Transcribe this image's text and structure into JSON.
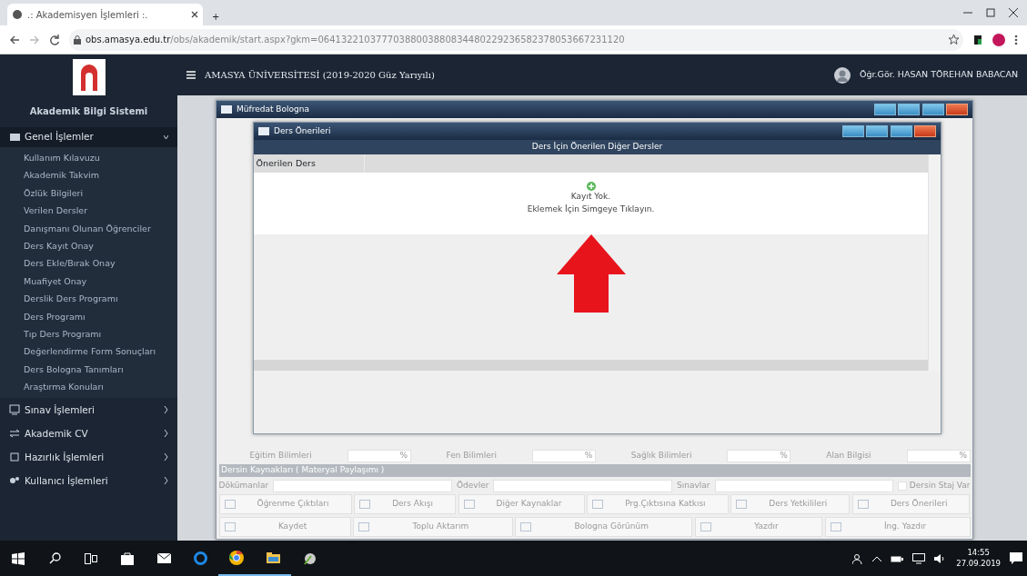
{
  "browser": {
    "tab_title": ".: Akademisyen İşlemleri :.",
    "new_tab": "+",
    "url": "**obs.amasya.edu.tr**/obs/akademik/start.aspx?gkm=06413221037770388003880834480229236582378053667231120"
  },
  "header": {
    "title": "AMASYA ÜNİVERSİTESİ (2019-2020 Güz Yarıyılı)",
    "user": "Öğr.Gör. HASAN TÖREHAN BABACAN"
  },
  "sidebar": {
    "title": "Akademik Bilgi Sistemi",
    "groups": [
      {
        "label": "Genel İşlemler",
        "expanded": true,
        "children": [
          {
            "label": "Kullanım Kılavuzu"
          },
          {
            "label": "Akademik Takvim"
          },
          {
            "label": "Özlük Bilgileri"
          },
          {
            "label": "Verilen Dersler"
          },
          {
            "label": "Danışmanı Olunan Öğrenciler"
          },
          {
            "label": "Ders Kayıt Onay"
          },
          {
            "label": "Ders Ekle/Bırak Onay"
          },
          {
            "label": "Muafiyet Onay"
          },
          {
            "label": "Derslik Ders Programı"
          },
          {
            "label": "Ders Programı"
          },
          {
            "label": "Tıp Ders Programı"
          },
          {
            "label": "Değerlendirme Form Sonuçları"
          },
          {
            "label": "Ders Bologna Tanımları"
          },
          {
            "label": "Araştırma Konuları"
          }
        ]
      },
      {
        "label": "Sınav İşlemleri",
        "expanded": false
      },
      {
        "label": "Akademik CV",
        "expanded": false
      },
      {
        "label": "Hazırlık İşlemleri",
        "expanded": false
      },
      {
        "label": "Kullanıcı İşlemleri",
        "expanded": false
      }
    ]
  },
  "bologna_window": {
    "title": "Müfredat Bologna",
    "percent_fields": [
      {
        "label": "Eğitim Bilimleri",
        "unit": "%"
      },
      {
        "label": "Fen Bilimleri",
        "unit": "%"
      },
      {
        "label": "Sağlık Bilimleri",
        "unit": "%"
      },
      {
        "label": "Alan Bilgisi",
        "unit": "%"
      }
    ],
    "section_title": "Dersin Kaynakları ( Materyal Paylaşımı )",
    "resource_fields": [
      {
        "label": "Dökümanlar"
      },
      {
        "label": "Ödevler"
      },
      {
        "label": "Sınavlar"
      }
    ],
    "internship_checkbox": {
      "label": "Dersin Staj Var",
      "checked": false
    },
    "tool_rows": [
      [
        "Öğrenme Çıktıları",
        "Ders Akışı",
        "Diğer Kaynaklar",
        "Prg.Çıktısına Katkısı",
        "Ders Yetkilileri",
        "Ders Önerileri"
      ],
      [
        "Kaydet",
        "Toplu Aktarım",
        "Bologna Görünüm",
        "Yazdır",
        "İng. Yazdır"
      ]
    ]
  },
  "dialog": {
    "title": "Ders Önerileri",
    "band_title": "Ders İçin Önerilen Diğer Dersler",
    "column": "Önerilen Ders",
    "empty_lines": [
      "Kayıt Yok.",
      "Eklemek İçin Simgeye Tıklayın."
    ]
  },
  "taskbar": {
    "time": "14:55",
    "date": "27.09.2019"
  }
}
